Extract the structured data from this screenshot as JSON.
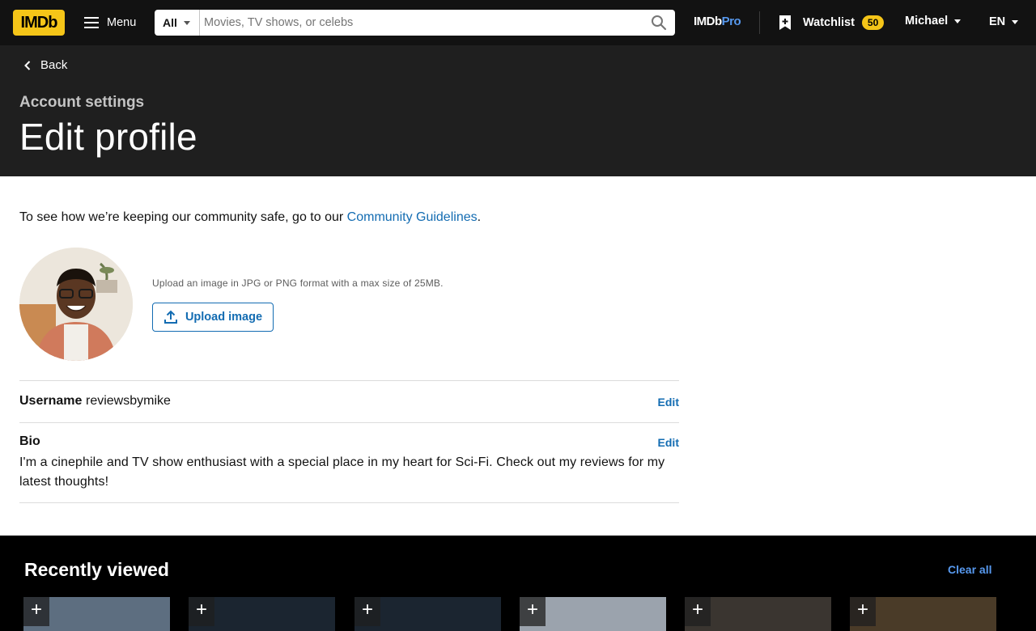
{
  "nav": {
    "logo": "IMDb",
    "menu_label": "Menu",
    "search_category": "All",
    "search_placeholder": "Movies, TV shows, or celebs",
    "pro_prefix": "IMDb",
    "pro_suffix": "Pro",
    "watchlist_label": "Watchlist",
    "watchlist_count": "50",
    "user_name": "Michael",
    "language": "EN"
  },
  "header": {
    "back_label": "Back",
    "subtitle": "Account settings",
    "title": "Edit profile"
  },
  "guidelines": {
    "text": "To see how we’re keeping our community safe, go to our ",
    "link": "Community Guidelines",
    "suffix": "."
  },
  "upload": {
    "hint": "Upload an image in JPG or PNG format with a max size of 25MB.",
    "button_label": "Upload image"
  },
  "username": {
    "label": "Username",
    "value": "reviewsbymike",
    "edit_label": "Edit"
  },
  "bio": {
    "label": "Bio",
    "value": "I'm a cinephile and TV show enthusiast with a special place in my heart for Sci-Fi. Check out my reviews for my latest thoughts!",
    "edit_label": "Edit"
  },
  "recently_viewed": {
    "title": "Recently viewed",
    "clear_label": "Clear all",
    "posters": [
      {
        "name": "poster-1",
        "color": "#5d6e80"
      },
      {
        "name": "poster-2",
        "color": "#1b2530"
      },
      {
        "name": "poster-3",
        "color": "#1b2530"
      },
      {
        "name": "poster-4",
        "color": "#9ba3ad"
      },
      {
        "name": "poster-5",
        "color": "#3a3530"
      },
      {
        "name": "poster-6",
        "color": "#4a3b28"
      }
    ]
  },
  "colors": {
    "brand_yellow": "#F5C518",
    "link_blue": "#136CB2",
    "nav_bg": "#121212",
    "header_bg": "#1f1f1f"
  }
}
